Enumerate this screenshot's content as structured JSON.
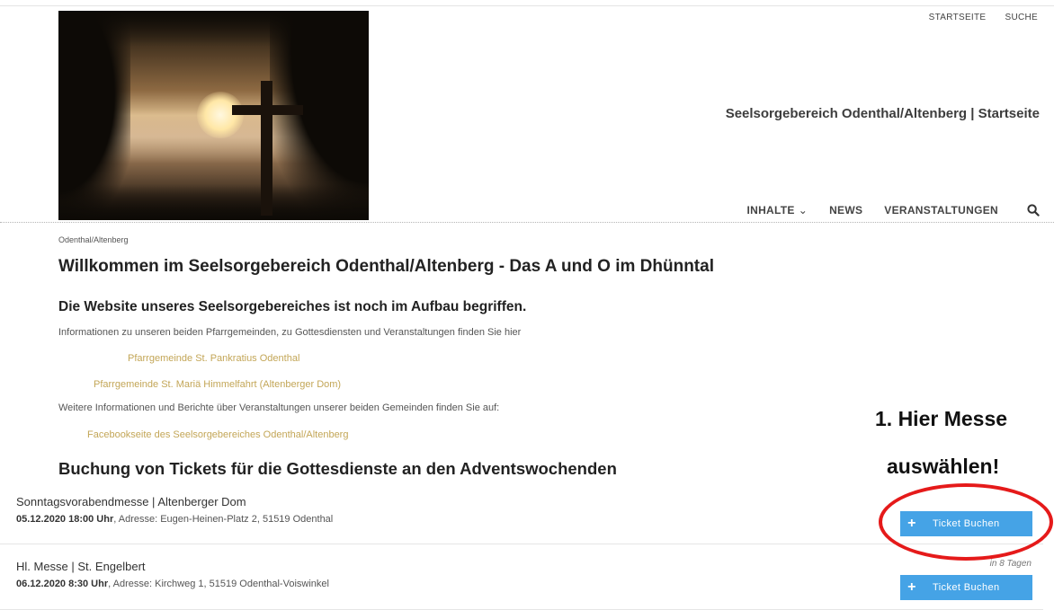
{
  "toplinks": {
    "home": "STARTSEITE",
    "search": "SUCHE"
  },
  "site_title": "Seelsorgebereich Odenthal/Altenberg | Startseite",
  "nav": {
    "inhalte": "INHALTE",
    "news": "NEWS",
    "events": "VERANSTALTUNGEN"
  },
  "breadcrumb": "Odenthal/Altenberg",
  "welcome_heading": "Willkommen im Seelsorgebereich Odenthal/Altenberg - Das A und O im Dhünntal",
  "subheading": "Die Website unseres Seelsorgebereiches ist noch im Aufbau begriffen.",
  "intro_text": "Informationen zu unseren beiden Pfarrgemeinden, zu Gottesdiensten und Veranstaltungen finden Sie hier",
  "links": {
    "pankratius": "Pfarrgemeinde St. Pankratius Odenthal",
    "maria": "Pfarrgemeinde St. Mariä Himmelfahrt (Altenberger Dom)",
    "facebook": "Facebookseite des Seelsorgebereiches Odenthal/Altenberg"
  },
  "more_text": "Weitere Informationen und Berichte über Veranstaltungen unserer beiden Gemeinden finden Sie auf:",
  "booking_heading": "Buchung von Tickets für die Gottesdienste an den Adventswochenden",
  "events": [
    {
      "title": "Sonntagsvorabendmesse | Altenberger Dom",
      "datetime": "05.12.2020 18:00 Uhr",
      "address": ", Adresse: Eugen-Heinen-Platz 2, 51519 Odenthal",
      "button": "Ticket Buchen"
    },
    {
      "title": "Hl. Messe | St. Engelbert",
      "datetime": "06.12.2020 8:30 Uhr",
      "address": ", Adresse: Kirchweg 1, 51519 Odenthal-Voiswinkel",
      "button": "Ticket Buchen",
      "relative": "in 8 Tagen"
    }
  ],
  "annotation": {
    "line1": "1. Hier Messe",
    "line2": "auswählen!",
    "color": "#e51a1a"
  },
  "colors": {
    "accent_button": "#45a3e6",
    "link": "#c3a657"
  }
}
